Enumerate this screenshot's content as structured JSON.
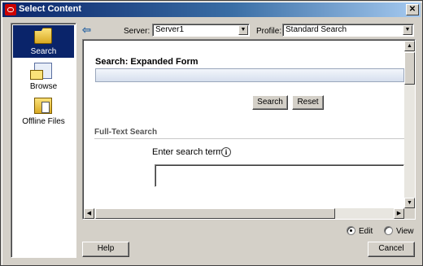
{
  "window": {
    "title": "Select Content",
    "close_glyph": "✕"
  },
  "sidebar": {
    "items": [
      {
        "label": "Search",
        "icon": "open-folder-icon"
      },
      {
        "label": "Browse",
        "icon": "browse-icon"
      },
      {
        "label": "Offline Files",
        "icon": "offline-files-icon"
      }
    ]
  },
  "toolbar": {
    "back_glyph": "⇦",
    "server_label": "Server:",
    "server_value": "Server1",
    "profile_label": "Profile:",
    "profile_value": "Standard Search"
  },
  "form": {
    "title": "Search: Expanded Form",
    "search_button": "Search",
    "reset_button": "Reset",
    "fulltext_heading": "Full-Text Search",
    "terms_label": "Enter search terms",
    "info_glyph": "i"
  },
  "mode": {
    "edit_label": "Edit",
    "view_label": "View",
    "selected": "Edit"
  },
  "footer": {
    "help_button": "Help",
    "cancel_button": "Cancel"
  },
  "colors": {
    "title_gradient_start": "#0a246a",
    "dialog_face": "#d4d0c8",
    "selected_nav": "#0a246a"
  }
}
